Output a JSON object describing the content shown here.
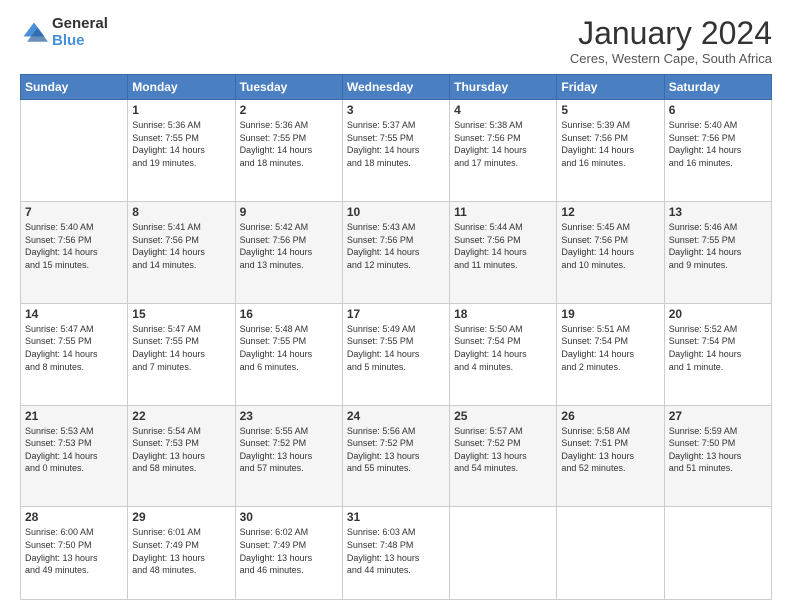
{
  "logo": {
    "general": "General",
    "blue": "Blue"
  },
  "header": {
    "title": "January 2024",
    "subtitle": "Ceres, Western Cape, South Africa"
  },
  "days_of_week": [
    "Sunday",
    "Monday",
    "Tuesday",
    "Wednesday",
    "Thursday",
    "Friday",
    "Saturday"
  ],
  "weeks": [
    [
      {
        "day": "",
        "info": ""
      },
      {
        "day": "1",
        "info": "Sunrise: 5:36 AM\nSunset: 7:55 PM\nDaylight: 14 hours\nand 19 minutes."
      },
      {
        "day": "2",
        "info": "Sunrise: 5:36 AM\nSunset: 7:55 PM\nDaylight: 14 hours\nand 18 minutes."
      },
      {
        "day": "3",
        "info": "Sunrise: 5:37 AM\nSunset: 7:55 PM\nDaylight: 14 hours\nand 18 minutes."
      },
      {
        "day": "4",
        "info": "Sunrise: 5:38 AM\nSunset: 7:56 PM\nDaylight: 14 hours\nand 17 minutes."
      },
      {
        "day": "5",
        "info": "Sunrise: 5:39 AM\nSunset: 7:56 PM\nDaylight: 14 hours\nand 16 minutes."
      },
      {
        "day": "6",
        "info": "Sunrise: 5:40 AM\nSunset: 7:56 PM\nDaylight: 14 hours\nand 16 minutes."
      }
    ],
    [
      {
        "day": "7",
        "info": "Sunrise: 5:40 AM\nSunset: 7:56 PM\nDaylight: 14 hours\nand 15 minutes."
      },
      {
        "day": "8",
        "info": "Sunrise: 5:41 AM\nSunset: 7:56 PM\nDaylight: 14 hours\nand 14 minutes."
      },
      {
        "day": "9",
        "info": "Sunrise: 5:42 AM\nSunset: 7:56 PM\nDaylight: 14 hours\nand 13 minutes."
      },
      {
        "day": "10",
        "info": "Sunrise: 5:43 AM\nSunset: 7:56 PM\nDaylight: 14 hours\nand 12 minutes."
      },
      {
        "day": "11",
        "info": "Sunrise: 5:44 AM\nSunset: 7:56 PM\nDaylight: 14 hours\nand 11 minutes."
      },
      {
        "day": "12",
        "info": "Sunrise: 5:45 AM\nSunset: 7:56 PM\nDaylight: 14 hours\nand 10 minutes."
      },
      {
        "day": "13",
        "info": "Sunrise: 5:46 AM\nSunset: 7:55 PM\nDaylight: 14 hours\nand 9 minutes."
      }
    ],
    [
      {
        "day": "14",
        "info": "Sunrise: 5:47 AM\nSunset: 7:55 PM\nDaylight: 14 hours\nand 8 minutes."
      },
      {
        "day": "15",
        "info": "Sunrise: 5:47 AM\nSunset: 7:55 PM\nDaylight: 14 hours\nand 7 minutes."
      },
      {
        "day": "16",
        "info": "Sunrise: 5:48 AM\nSunset: 7:55 PM\nDaylight: 14 hours\nand 6 minutes."
      },
      {
        "day": "17",
        "info": "Sunrise: 5:49 AM\nSunset: 7:55 PM\nDaylight: 14 hours\nand 5 minutes."
      },
      {
        "day": "18",
        "info": "Sunrise: 5:50 AM\nSunset: 7:54 PM\nDaylight: 14 hours\nand 4 minutes."
      },
      {
        "day": "19",
        "info": "Sunrise: 5:51 AM\nSunset: 7:54 PM\nDaylight: 14 hours\nand 2 minutes."
      },
      {
        "day": "20",
        "info": "Sunrise: 5:52 AM\nSunset: 7:54 PM\nDaylight: 14 hours\nand 1 minute."
      }
    ],
    [
      {
        "day": "21",
        "info": "Sunrise: 5:53 AM\nSunset: 7:53 PM\nDaylight: 14 hours\nand 0 minutes."
      },
      {
        "day": "22",
        "info": "Sunrise: 5:54 AM\nSunset: 7:53 PM\nDaylight: 13 hours\nand 58 minutes."
      },
      {
        "day": "23",
        "info": "Sunrise: 5:55 AM\nSunset: 7:52 PM\nDaylight: 13 hours\nand 57 minutes."
      },
      {
        "day": "24",
        "info": "Sunrise: 5:56 AM\nSunset: 7:52 PM\nDaylight: 13 hours\nand 55 minutes."
      },
      {
        "day": "25",
        "info": "Sunrise: 5:57 AM\nSunset: 7:52 PM\nDaylight: 13 hours\nand 54 minutes."
      },
      {
        "day": "26",
        "info": "Sunrise: 5:58 AM\nSunset: 7:51 PM\nDaylight: 13 hours\nand 52 minutes."
      },
      {
        "day": "27",
        "info": "Sunrise: 5:59 AM\nSunset: 7:50 PM\nDaylight: 13 hours\nand 51 minutes."
      }
    ],
    [
      {
        "day": "28",
        "info": "Sunrise: 6:00 AM\nSunset: 7:50 PM\nDaylight: 13 hours\nand 49 minutes."
      },
      {
        "day": "29",
        "info": "Sunrise: 6:01 AM\nSunset: 7:49 PM\nDaylight: 13 hours\nand 48 minutes."
      },
      {
        "day": "30",
        "info": "Sunrise: 6:02 AM\nSunset: 7:49 PM\nDaylight: 13 hours\nand 46 minutes."
      },
      {
        "day": "31",
        "info": "Sunrise: 6:03 AM\nSunset: 7:48 PM\nDaylight: 13 hours\nand 44 minutes."
      },
      {
        "day": "",
        "info": ""
      },
      {
        "day": "",
        "info": ""
      },
      {
        "day": "",
        "info": ""
      }
    ]
  ]
}
